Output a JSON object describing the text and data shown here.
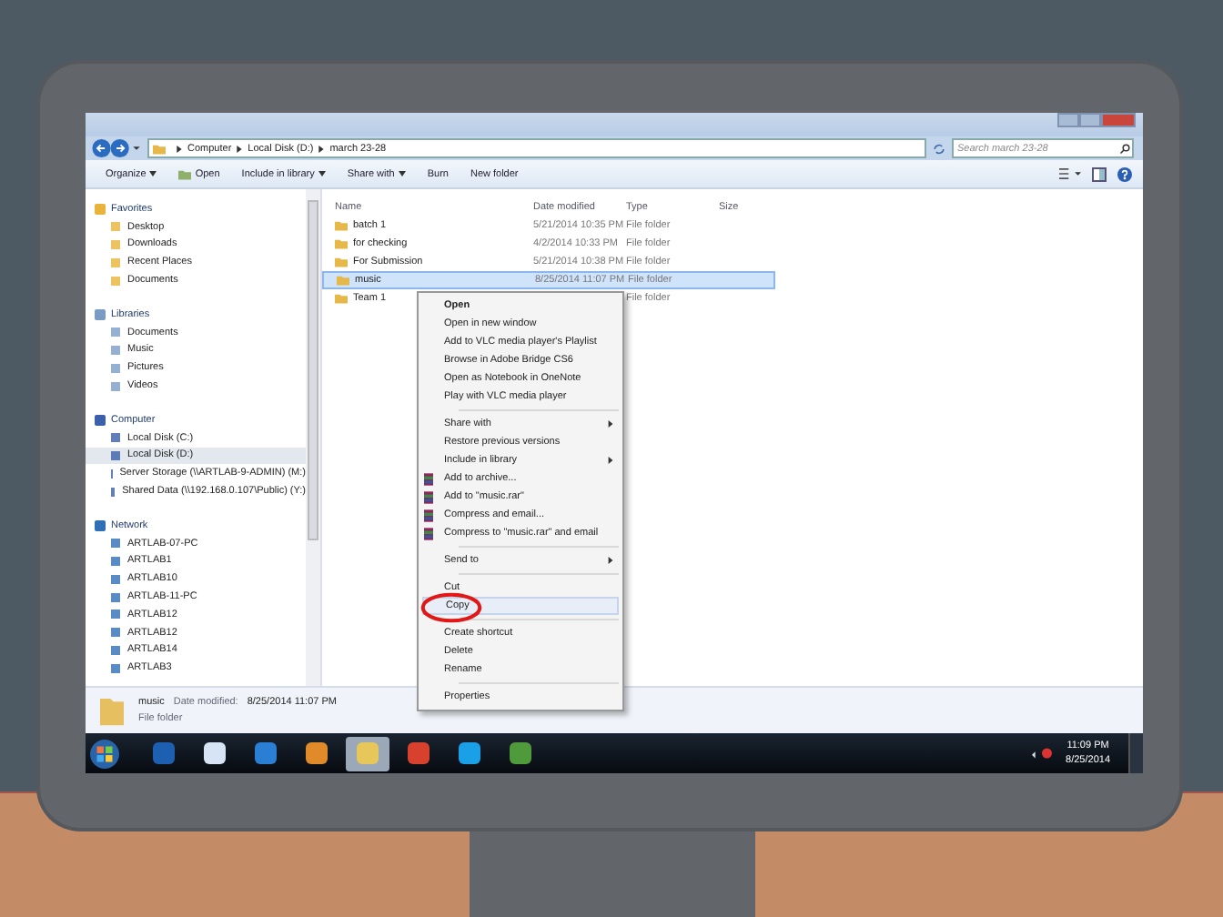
{
  "address_bar": {
    "breadcrumbs": [
      "Computer",
      "Local Disk (D:)",
      "march 23-28"
    ],
    "search": {
      "placeholder": "Search march 23-28"
    }
  },
  "toolbar": {
    "buttons": [
      {
        "label": "Organize",
        "dropdown": true,
        "kind": "plain"
      },
      {
        "label": "Open",
        "dropdown": false,
        "kind": "open"
      },
      {
        "label": "Include in library",
        "dropdown": true,
        "kind": "plain"
      },
      {
        "label": "Share with",
        "dropdown": true,
        "kind": "plain"
      },
      {
        "label": "Burn",
        "dropdown": false,
        "kind": "plain"
      },
      {
        "label": "New folder",
        "dropdown": false,
        "kind": "plain"
      }
    ]
  },
  "sidebar": {
    "groups": [
      {
        "label": "Favorites",
        "kind": "favorites",
        "children": [
          {
            "label": "Desktop",
            "selected": false
          },
          {
            "label": "Downloads",
            "selected": false
          },
          {
            "label": "Recent Places",
            "selected": false
          },
          {
            "label": "Documents",
            "selected": false
          }
        ]
      },
      {
        "label": "Libraries",
        "kind": "libraries",
        "children": [
          {
            "label": "Documents",
            "selected": false
          },
          {
            "label": "Music",
            "selected": false
          },
          {
            "label": "Pictures",
            "selected": false
          },
          {
            "label": "Videos",
            "selected": false
          }
        ]
      },
      {
        "label": "Computer",
        "kind": "computer",
        "children": [
          {
            "label": "Local Disk (C:)",
            "selected": false
          },
          {
            "label": "Local Disk (D:)",
            "selected": true
          },
          {
            "label": "Server Storage (\\\\ARTLAB-9-ADMIN) (M:)",
            "selected": false
          },
          {
            "label": "Shared Data (\\\\192.168.0.107\\Public) (Y:)",
            "selected": false
          }
        ]
      },
      {
        "label": "Network",
        "kind": "network",
        "children": [
          {
            "label": "ARTLAB-07-PC",
            "selected": false
          },
          {
            "label": "ARTLAB1",
            "selected": false
          },
          {
            "label": "ARTLAB10",
            "selected": false
          },
          {
            "label": "ARTLAB-11-PC",
            "selected": false
          },
          {
            "label": "ARTLAB12",
            "selected": false
          },
          {
            "label": "ARTLAB12",
            "selected": false
          },
          {
            "label": "ARTLAB14",
            "selected": false
          },
          {
            "label": "ARTLAB3",
            "selected": false
          }
        ]
      }
    ]
  },
  "table": {
    "columns": [
      "Name",
      "Date modified",
      "Type",
      "Size"
    ],
    "rows": [
      {
        "name": "batch 1",
        "date": "5/21/2014 10:35 PM",
        "type": "File folder",
        "selected": false
      },
      {
        "name": "for checking",
        "date": "4/2/2014 10:33 PM",
        "type": "File folder",
        "selected": false
      },
      {
        "name": "For Submission",
        "date": "5/21/2014 10:38 PM",
        "type": "File folder",
        "selected": false
      },
      {
        "name": "music",
        "date": "8/25/2014 11:07 PM",
        "type": "File folder",
        "selected": true
      },
      {
        "name": "Team 1",
        "type": "File folder",
        "selected": false
      }
    ]
  },
  "context_menu": {
    "groups": [
      [
        {
          "label": "Open",
          "kind": "default",
          "selected": false
        },
        {
          "label": "Open in new window",
          "kind": "plain",
          "selected": false
        },
        {
          "label": "Add to VLC media player's Playlist",
          "kind": "plain",
          "selected": false
        },
        {
          "label": "Browse in Adobe Bridge CS6",
          "kind": "plain",
          "selected": false
        },
        {
          "label": "Open as Notebook in OneNote",
          "kind": "plain",
          "selected": false
        },
        {
          "label": "Play with VLC media player",
          "kind": "plain",
          "selected": false
        }
      ],
      [
        {
          "label": "Share with",
          "kind": "submenu",
          "selected": false
        },
        {
          "label": "Restore previous versions",
          "kind": "plain",
          "selected": false
        },
        {
          "label": "Include in library",
          "kind": "submenu",
          "selected": false
        },
        {
          "label": "Add to archive...",
          "kind": "archive",
          "selected": false
        },
        {
          "label": "Add to \"music.rar\"",
          "kind": "archive",
          "selected": false
        },
        {
          "label": "Compress and email...",
          "kind": "archive",
          "selected": false
        },
        {
          "label": "Compress to \"music.rar\" and email",
          "kind": "archive",
          "selected": false
        }
      ],
      [
        {
          "label": "Send to",
          "kind": "submenu",
          "selected": false
        }
      ],
      [
        {
          "label": "Cut",
          "kind": "plain",
          "selected": false
        },
        {
          "label": "Copy",
          "kind": "plain",
          "selected": true
        }
      ],
      [
        {
          "label": "Create shortcut",
          "kind": "plain",
          "selected": false
        },
        {
          "label": "Delete",
          "kind": "plain",
          "selected": false
        },
        {
          "label": "Rename",
          "kind": "plain",
          "selected": false
        }
      ],
      [
        {
          "label": "Properties",
          "kind": "plain",
          "selected": false
        }
      ]
    ]
  },
  "status_bar": {
    "name": "music",
    "date_label": "Date modified:",
    "date": "8/25/2014 11:07 PM",
    "type": "File folder"
  },
  "taskbar": {
    "apps": [
      {
        "kind": "calendar",
        "active": false
      },
      {
        "kind": "notepad",
        "active": false
      },
      {
        "kind": "browser",
        "active": false
      },
      {
        "kind": "media",
        "active": false
      },
      {
        "kind": "explorer",
        "active": true
      },
      {
        "kind": "chrome",
        "active": false
      },
      {
        "kind": "skype",
        "active": false
      },
      {
        "kind": "game",
        "active": false
      }
    ],
    "clock": {
      "time": "11:09 PM",
      "date": "8/25/2014"
    }
  }
}
